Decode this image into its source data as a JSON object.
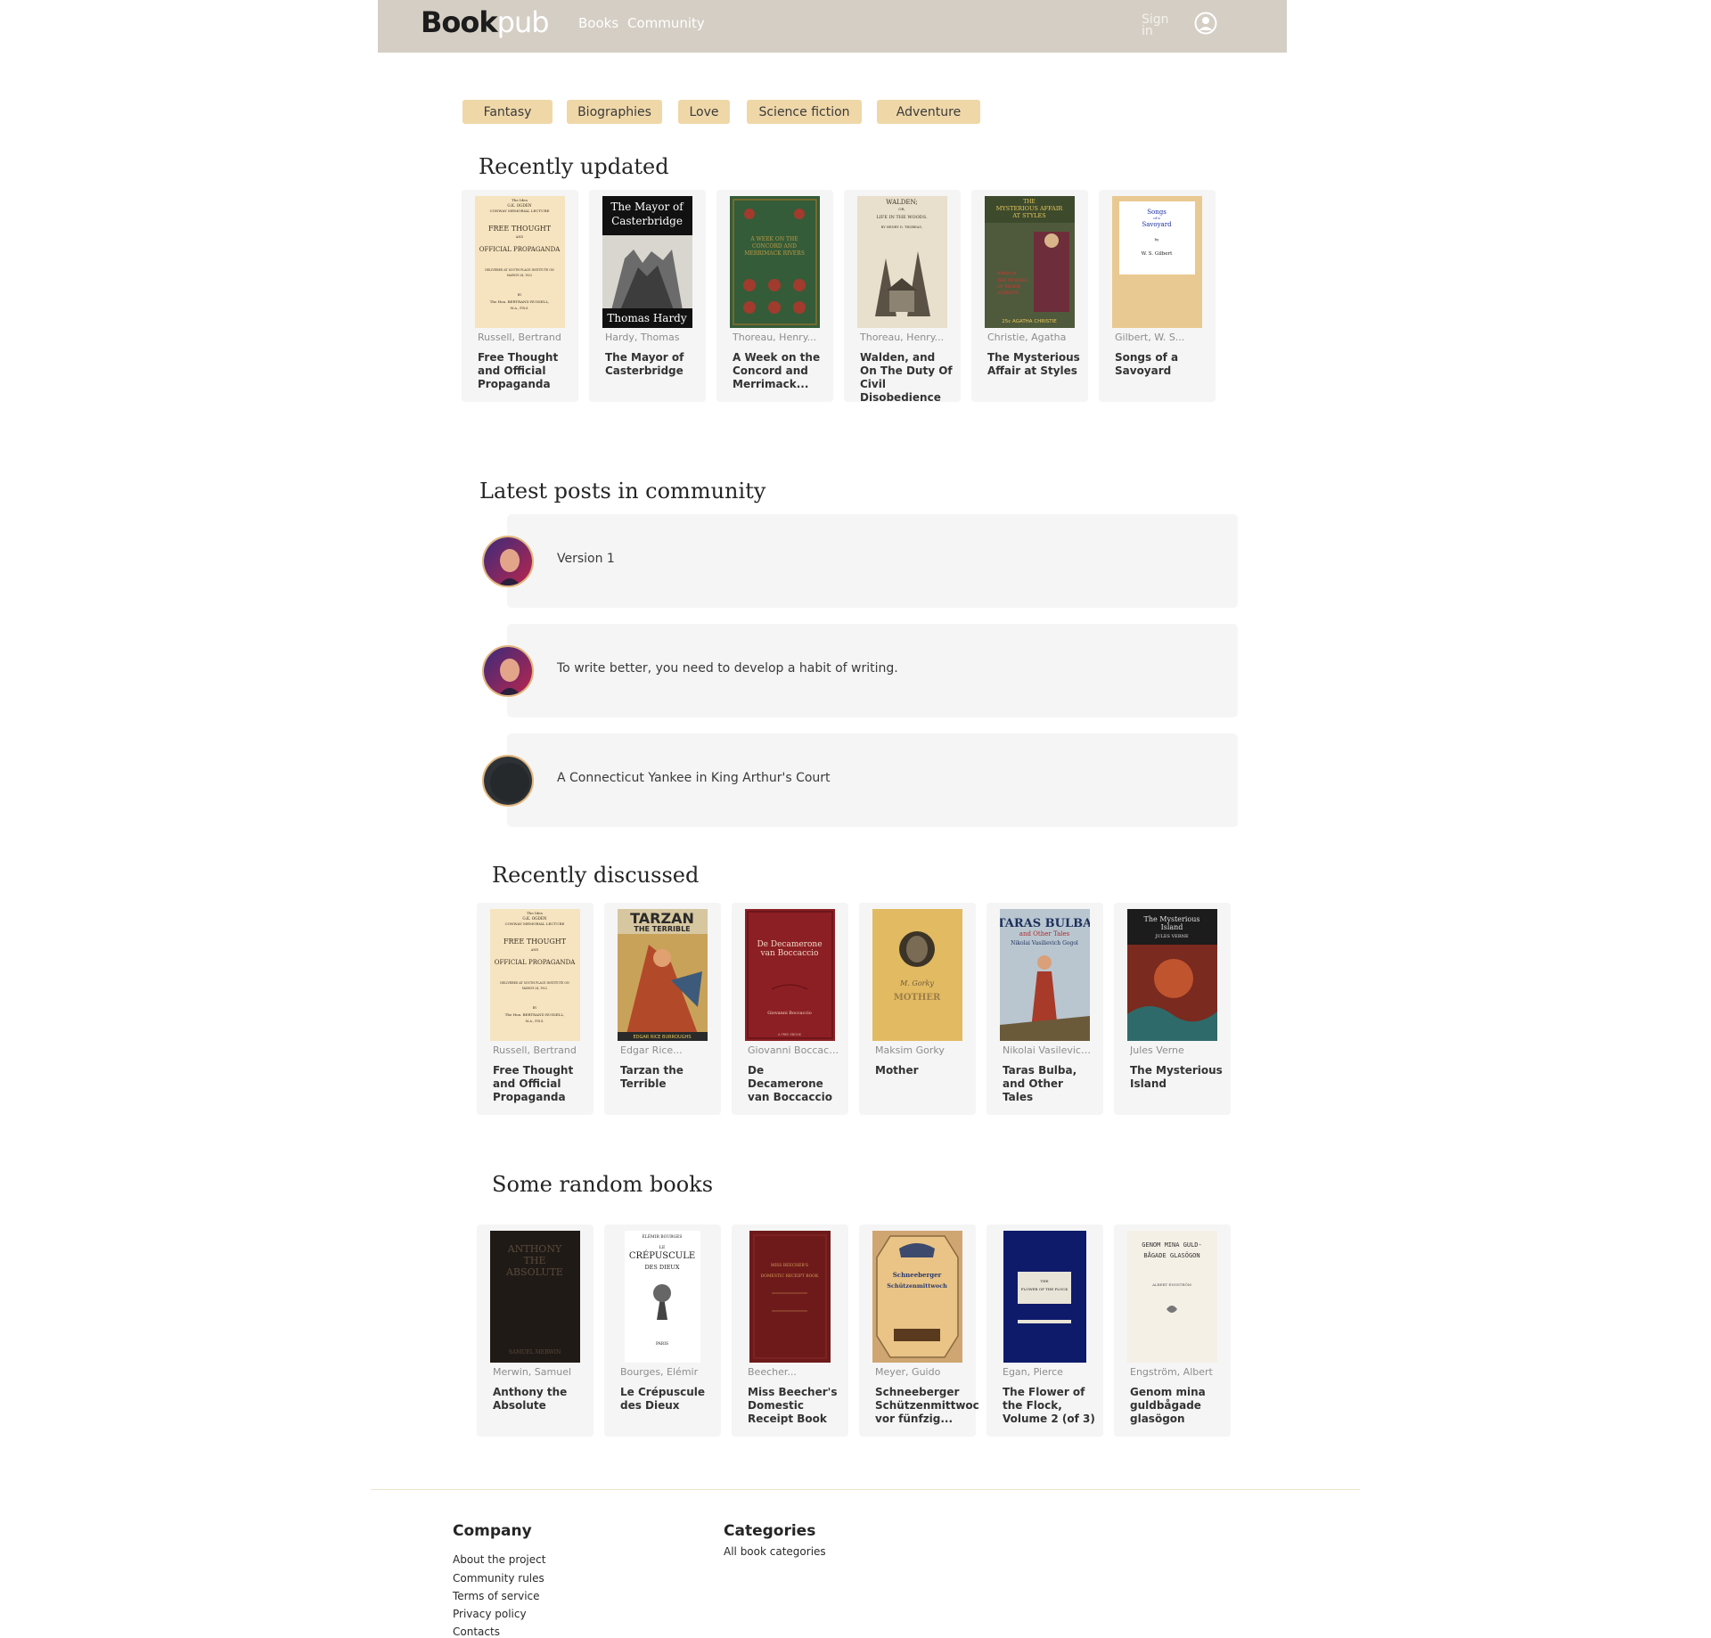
{
  "header": {
    "logo_part1": "Book",
    "logo_part2": "pub",
    "nav_books": "Books",
    "nav_community": "Community",
    "sign_in": "Sign in"
  },
  "genres": [
    "Fantasy",
    "Biographies",
    "Love",
    "Science fiction",
    "Adventure"
  ],
  "recently_updated": {
    "title": "Recently updated",
    "books": [
      {
        "author": "Russell, Bertrand",
        "title": "Free Thought and Official Propaganda"
      },
      {
        "author": "Hardy, Thomas",
        "title": "The Mayor of Casterbridge"
      },
      {
        "author": "Thoreau, Henry...",
        "title": "A Week on the Concord and Merrimack..."
      },
      {
        "author": "Thoreau, Henry...",
        "title": "Walden, and On The Duty Of Civil Disobedience"
      },
      {
        "author": "Christie, Agatha",
        "title": "The Mysterious Affair at Styles"
      },
      {
        "author": "Gilbert, W. S...",
        "title": "Songs of a Savoyard"
      }
    ]
  },
  "community": {
    "title": "Latest posts in community",
    "posts": [
      {
        "text": "Version 1"
      },
      {
        "text": "To write better, you need to develop a habit of writing."
      },
      {
        "text": "A Connecticut Yankee in King Arthur's Court"
      }
    ]
  },
  "recently_discussed": {
    "title": "Recently discussed",
    "books": [
      {
        "author": "Russell, Bertrand",
        "title": "Free Thought and Official Propaganda"
      },
      {
        "author": "Edgar Rice...",
        "title": "Tarzan the Terrible"
      },
      {
        "author": "Giovanni Boccaccio",
        "title": "De Decamerone van Boccaccio"
      },
      {
        "author": "Maksim Gorky",
        "title": "Mother"
      },
      {
        "author": "Nikolai Vasilevich...",
        "title": "Taras Bulba, and Other Tales"
      },
      {
        "author": "Jules Verne",
        "title": "The Mysterious Island"
      }
    ]
  },
  "random_books": {
    "title": "Some random books",
    "books": [
      {
        "author": "Merwin, Samuel",
        "title": "Anthony the Absolute"
      },
      {
        "author": "Bourges, Elémir",
        "title": "Le Crépuscule des Dieux"
      },
      {
        "author": "Beecher...",
        "title": "Miss Beecher's Domestic Receipt Book"
      },
      {
        "author": "Meyer, Guido",
        "title": "Schneeberger Schützenmittwoc vor fünfzig..."
      },
      {
        "author": "Egan, Pierce",
        "title": "The Flower of the Flock, Volume 2 (of 3)"
      },
      {
        "author": "Engström, Albert",
        "title": "Genom mina guldbågade glasögon"
      }
    ]
  },
  "covers": {
    "c_russell": {
      "l1": "The Idea",
      "l2": "G.K. OGDEN",
      "l3": "CONWAY MEMORIAL LECTURE",
      "l4": "FREE THOUGHT",
      "l5": "AND",
      "l6": "OFFICIAL PROPAGANDA",
      "l7": "DELIVERED AT SOUTH PLACE INSTITUTE ON",
      "l8": "MARCH 24, 1922",
      "l9": "BY",
      "l10": "The Hon. BERTRAND RUSSELL,",
      "l11": "M.A., F.R.S."
    },
    "c_mayor": {
      "l1": "The Mayor of",
      "l2": "Casterbridge",
      "l3": "Thomas Hardy"
    },
    "c_week": {
      "l1": "A WEEK ON THE",
      "l2": "CONCORD AND",
      "l3": "MERRIMACK RIVERS"
    },
    "c_walden": {
      "l1": "WALDEN;",
      "l2": "OR,",
      "l3": "LIFE IN THE WOODS.",
      "l4": "BY HENRY D. THOREAU,"
    },
    "c_styles": {
      "l1": "THE",
      "l2": "MYSTERIOUS AFFAIR",
      "l3": "AT STYLES",
      "l4": "Author of",
      "l5": "THE MURDER",
      "l6": "OF ROGER",
      "l7": "ACKROYD",
      "l8": "25c AGATHA CHRISTIE"
    },
    "c_savoyard": {
      "l1": "Songs",
      "l2": "of a",
      "l3": "Savoyard",
      "l4": "by",
      "l5": "W. S. Gilbert"
    },
    "c_tarzan": {
      "l1": "TARZAN",
      "l2": "THE TERRIBLE",
      "l3": "EDGAR RICE BURROUGHS"
    },
    "c_decamerone": {
      "l1": "De Decamerone",
      "l2": "van Boccaccio",
      "l3": "Giovanni Boccaccio",
      "l4": "A FREE EBOOK"
    },
    "c_mother": {
      "l1": "M. Gorky",
      "l2": "MOTHER"
    },
    "c_taras": {
      "l1": "TARAS BULBA",
      "l2": "and Other Tales",
      "l3": "Nikolai Vasilievich Gogol"
    },
    "c_island": {
      "l1": "The Mysterious",
      "l2": "Island",
      "l3": "JULES VERNE"
    },
    "c_anthony": {
      "l1": "ANTHONY",
      "l2": "THE",
      "l3": "ABSOLUTE",
      "l4": "SAMUEL MERWIN"
    },
    "c_crepuscule": {
      "l1": "ÉLÉMIR BOURGES",
      "l2": "LE",
      "l3": "CRÉPUSCULE",
      "l4": "DES DIEUX",
      "l5": "PARIS"
    },
    "c_beecher": {
      "l1": "MISS BEECHER'S",
      "l2": "DOMESTIC RECEIPT BOOK"
    },
    "c_schnee": {
      "l1": "Schneeberger",
      "l2": "Schützenmittwoch"
    },
    "c_flower": {
      "l1": "THE",
      "l2": "FLOWER OF THE FLOCK"
    },
    "c_genom": {
      "l1": "GENOM MINA GULD-",
      "l2": "BÅGADE GLASÖGON",
      "l3": "ALBERT ENGSTRÖM"
    }
  },
  "footer": {
    "company_title": "Company",
    "company_links": [
      "About the project",
      "Community rules",
      "Terms of service",
      "Privacy policy",
      "Contacts"
    ],
    "categories_title": "Categories",
    "categories_links": [
      "All book categories"
    ]
  },
  "colors": {
    "header_bg": "#d4cec4",
    "chip_bg": "#efd7a8",
    "card_bg": "#f5f5f5"
  }
}
